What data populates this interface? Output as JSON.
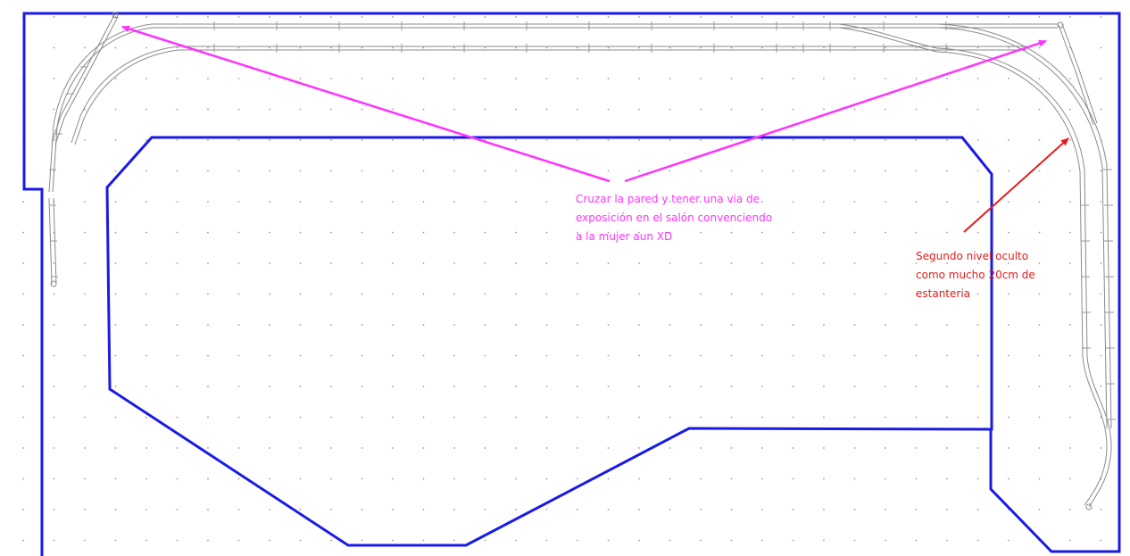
{
  "colors": {
    "background": "#ffffff",
    "grid_dot": "#9a9a9a",
    "wall": "#1a1ae6",
    "track": "#8a8a8a",
    "magenta": "#ff33ff",
    "red": "#e61a1a"
  },
  "annotations": {
    "magenta": {
      "lines": [
        "Cruzar la pared y tener una via de",
        "exposición en el salón convenciendo",
        "a la mujer aun XD"
      ]
    },
    "red": {
      "lines": [
        "Segundo nivel oculto",
        "como mucho  20cm de",
        "estanteria"
      ]
    }
  }
}
